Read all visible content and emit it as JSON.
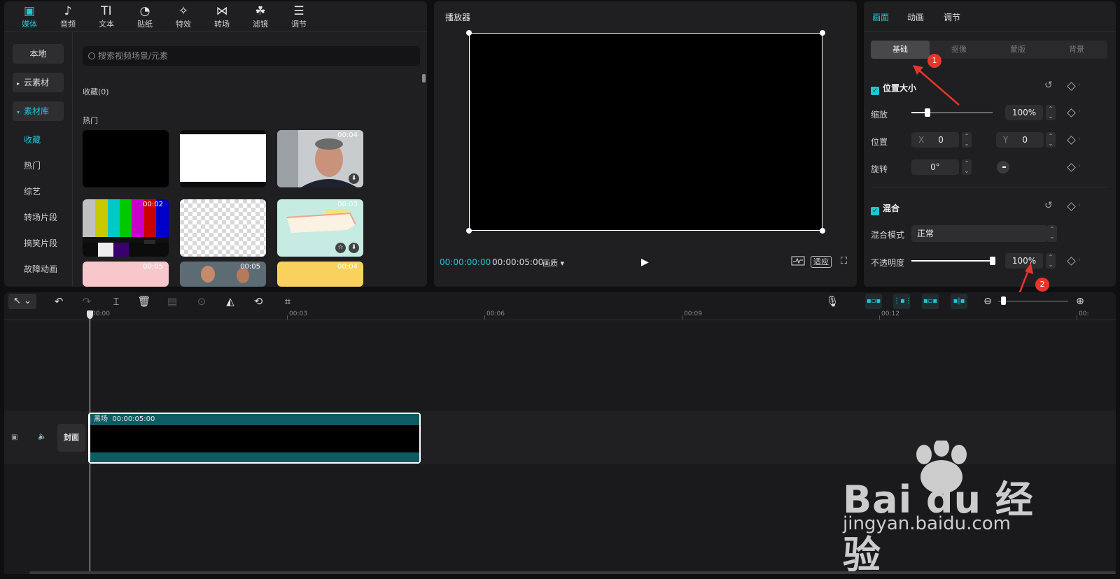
{
  "media": {
    "tabs": [
      {
        "label": "媒体",
        "icon": "media-icon",
        "glyph": "▣"
      },
      {
        "label": "音频",
        "icon": "audio-icon",
        "glyph": "♪"
      },
      {
        "label": "文本",
        "icon": "text-icon",
        "glyph": "TI"
      },
      {
        "label": "贴纸",
        "icon": "sticker-icon",
        "glyph": "◔"
      },
      {
        "label": "特效",
        "icon": "effects-icon",
        "glyph": "✧"
      },
      {
        "label": "转场",
        "icon": "transition-icon",
        "glyph": "⋈"
      },
      {
        "label": "滤镜",
        "icon": "filter-icon",
        "glyph": "☘"
      },
      {
        "label": "调节",
        "icon": "adjust-icon",
        "glyph": "☰"
      }
    ],
    "sidebar": {
      "local": "本地",
      "cloud": "云素材",
      "library": "素材库",
      "items": [
        "收藏",
        "热门",
        "综艺",
        "转场片段",
        "搞笑片段",
        "故障动画"
      ]
    },
    "search_placeholder": "搜索视频场景/元素",
    "favorites_label": "收藏(0)",
    "hot_label": "热门",
    "thumbs": [
      {
        "duration": "",
        "kind": "black"
      },
      {
        "duration": "",
        "kind": "white"
      },
      {
        "duration": "00:04",
        "kind": "person"
      },
      {
        "duration": "00:02",
        "kind": "colorbars"
      },
      {
        "duration": "",
        "kind": "transparent"
      },
      {
        "duration": "00:03",
        "kind": "paper"
      },
      {
        "duration": "00:05",
        "kind": "pink"
      },
      {
        "duration": "00:05",
        "kind": "people"
      },
      {
        "duration": "00:04",
        "kind": "yellow"
      }
    ]
  },
  "player": {
    "title": "播放器",
    "current_time": "00:00:00:00",
    "total_time": "00:00:05:00",
    "quality": "画质",
    "fit": "适应"
  },
  "props": {
    "tabs": [
      "画面",
      "动画",
      "调节"
    ],
    "subtabs": [
      "基础",
      "抠像",
      "蒙版",
      "背景"
    ],
    "position_size": {
      "title": "位置大小",
      "scale_label": "缩放",
      "scale_value": "100%",
      "scale_level": 0.2,
      "position_label": "位置",
      "x_label": "X",
      "x_value": "0",
      "y_label": "Y",
      "y_value": "0",
      "rotation_label": "旋转",
      "rotation_value": "0°"
    },
    "blend": {
      "title": "混合",
      "mode_label": "混合模式",
      "mode_value": "正常",
      "opacity_label": "不透明度",
      "opacity_value": "100%",
      "opacity_level": 1.0
    },
    "annotations": [
      "1",
      "2"
    ],
    "accent_color": "#21c5d6"
  },
  "timeline": {
    "ruler": [
      "00:00",
      "00:03",
      "00:06",
      "00:09",
      "00:12",
      "00:"
    ],
    "cover": "封面",
    "clip_name": "黑场",
    "clip_duration": "00:00:05:00"
  },
  "watermark": {
    "brand": "Bai du 经验",
    "url": "jingyan.baidu.com"
  }
}
